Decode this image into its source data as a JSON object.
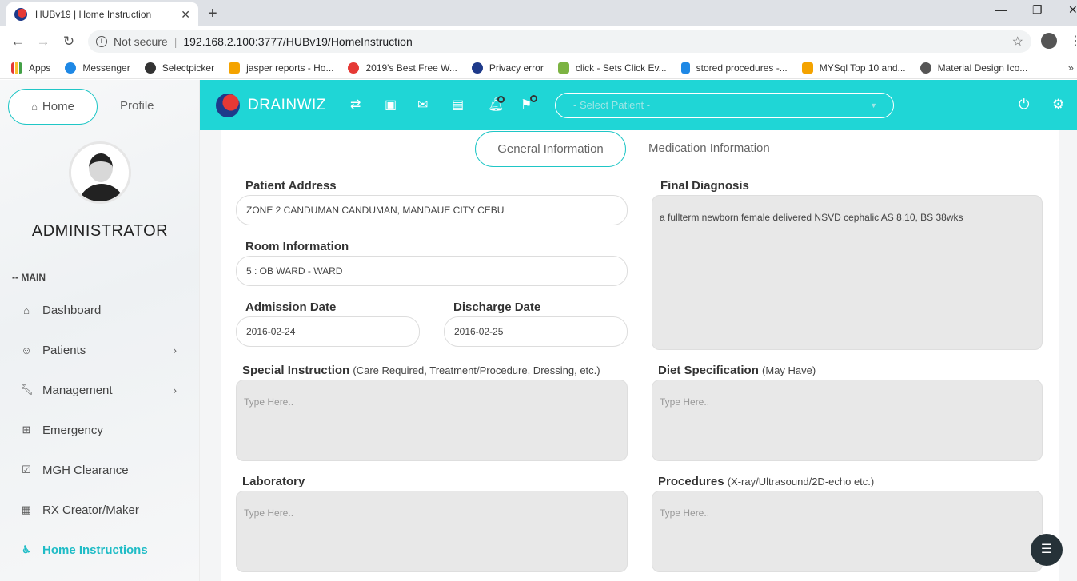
{
  "browser": {
    "tab_title": "HUBv19 | Home Instruction",
    "security": "Not secure",
    "url": "192.168.2.100:3777/HUBv19/HomeInstruction",
    "bookmarks": [
      {
        "label": "Apps",
        "color": "#e53935"
      },
      {
        "label": "Messenger",
        "color": "#1e88e5"
      },
      {
        "label": "Selectpicker",
        "color": "#333333"
      },
      {
        "label": "jasper reports - Ho...",
        "color": "#f4a300"
      },
      {
        "label": "2019's Best Free W...",
        "color": "#e53935"
      },
      {
        "label": "Privacy error",
        "color": "#1e3a8a"
      },
      {
        "label": "click - Sets Click Ev...",
        "color": "#7cb342"
      },
      {
        "label": "stored procedures -...",
        "color": "#1e88e5"
      },
      {
        "label": "MYSql Top 10 and...",
        "color": "#f4a300"
      },
      {
        "label": "Material Design Ico...",
        "color": "#555555"
      }
    ]
  },
  "sidebar": {
    "home_label": "Home",
    "profile_label": "Profile",
    "user_name": "ADMINISTRATOR",
    "section_label": "-- MAIN",
    "items": [
      {
        "label": "Dashboard",
        "icon": "home-icon",
        "has_chevron": false
      },
      {
        "label": "Patients",
        "icon": "smile-icon",
        "has_chevron": true
      },
      {
        "label": "Management",
        "icon": "wrench-icon",
        "has_chevron": true
      },
      {
        "label": "Emergency",
        "icon": "plus-box-icon",
        "has_chevron": false
      },
      {
        "label": "MGH Clearance",
        "icon": "checkbox-icon",
        "has_chevron": false
      },
      {
        "label": "RX Creator/Maker",
        "icon": "grid-icon",
        "has_chevron": false
      },
      {
        "label": "Home Instructions",
        "icon": "wheelchair-icon",
        "has_chevron": false,
        "active": true
      }
    ]
  },
  "topbar": {
    "brand": "DRAINWIZ",
    "patient_placeholder": "- Select Patient -",
    "accent": "#1fd6d6"
  },
  "tabs": {
    "general": "General Information",
    "medication": "Medication Information"
  },
  "form": {
    "patient_address_label": "Patient Address",
    "patient_address": "ZONE 2 CANDUMAN CANDUMAN, MANDAUE CITY CEBU",
    "room_label": "Room Information",
    "room": "5 : OB WARD - WARD",
    "admission_label": "Admission Date",
    "admission": "2016-02-24",
    "discharge_label": "Discharge Date",
    "discharge": "2016-02-25",
    "final_diagnosis_label": "Final Diagnosis",
    "final_diagnosis": "a fullterm newborn female delivered NSVD cephalic AS 8,10, BS 38wks",
    "special_label": "Special Instruction",
    "special_sub": "(Care Required, Treatment/Procedure, Dressing, etc.)",
    "diet_label": "Diet Specification",
    "diet_sub": "(May Have)",
    "laboratory_label": "Laboratory",
    "procedures_label": "Procedures",
    "procedures_sub": "(X-ray/Ultrasound/2D-echo etc.)",
    "placeholder": "Type Here.."
  }
}
